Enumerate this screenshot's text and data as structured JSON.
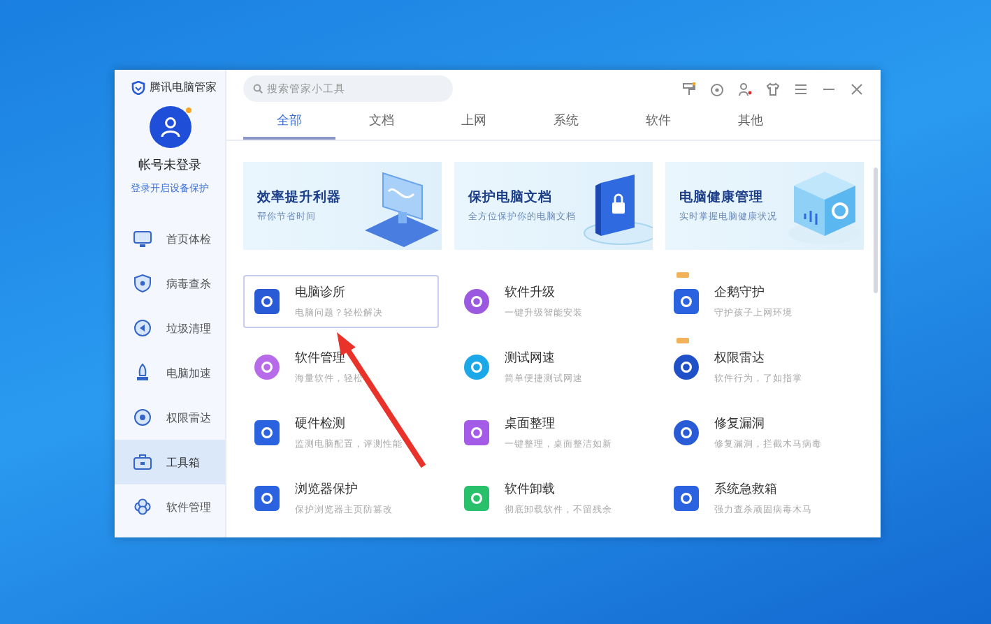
{
  "sidebar": {
    "brand": "腾讯电脑管家",
    "account": {
      "name": "帐号未登录",
      "link": "登录开启设备保护"
    },
    "items": [
      {
        "label": "首页体检",
        "selected": false
      },
      {
        "label": "病毒查杀",
        "selected": false
      },
      {
        "label": "垃圾清理",
        "selected": false
      },
      {
        "label": "电脑加速",
        "selected": false
      },
      {
        "label": "权限雷达",
        "selected": false
      },
      {
        "label": "工具箱",
        "selected": true
      },
      {
        "label": "软件管理",
        "selected": false
      }
    ]
  },
  "search": {
    "placeholder": "搜索管家小工具"
  },
  "tabs": [
    {
      "label": "全部",
      "selected": true
    },
    {
      "label": "文档",
      "selected": false
    },
    {
      "label": "上网",
      "selected": false
    },
    {
      "label": "系统",
      "selected": false
    },
    {
      "label": "软件",
      "selected": false
    },
    {
      "label": "其他",
      "selected": false
    }
  ],
  "banners": [
    {
      "title": "效率提升利器",
      "subtitle": "帮你节省时间"
    },
    {
      "title": "保护电脑文档",
      "subtitle": "全方位保护你的电脑文档"
    },
    {
      "title": "电脑健康管理",
      "subtitle": "实时掌握电脑健康状况"
    }
  ],
  "tools": [
    {
      "name": "电脑诊所",
      "desc": "电脑问题？轻松解决",
      "kind": "square",
      "color": "#2a5bd7",
      "highlighted": true,
      "badge": false
    },
    {
      "name": "软件升级",
      "desc": "一键升级智能安装",
      "kind": "circle",
      "color": "#9b59e0",
      "highlighted": false,
      "badge": false
    },
    {
      "name": "企鹅守护",
      "desc": "守护孩子上网环境",
      "kind": "square",
      "color": "#2a62e0",
      "highlighted": false,
      "badge": true
    },
    {
      "name": "软件管理",
      "desc": "海量软件，轻松",
      "kind": "circle",
      "color": "#b86be8",
      "highlighted": false,
      "badge": false
    },
    {
      "name": "测试网速",
      "desc": "简单便捷测试网速",
      "kind": "circle",
      "color": "#1aa8e8",
      "highlighted": false,
      "badge": false
    },
    {
      "name": "权限雷达",
      "desc": "软件行为，了如指掌",
      "kind": "circle",
      "color": "#2050c8",
      "highlighted": false,
      "badge": true
    },
    {
      "name": "硬件检测",
      "desc": "监测电脑配置，评测性能",
      "kind": "square",
      "color": "#2a62e0",
      "highlighted": false,
      "badge": false
    },
    {
      "name": "桌面整理",
      "desc": "一键整理，桌面整洁如新",
      "kind": "square",
      "color": "#a35be8",
      "highlighted": false,
      "badge": false
    },
    {
      "name": "修复漏洞",
      "desc": "修复漏洞，拦截木马病毒",
      "kind": "circle",
      "color": "#2a5bd7",
      "highlighted": false,
      "badge": false
    },
    {
      "name": "浏览器保护",
      "desc": "保护浏览器主页防篡改",
      "kind": "square",
      "color": "#2a62e0",
      "highlighted": false,
      "badge": false
    },
    {
      "name": "软件卸载",
      "desc": "彻底卸载软件，不留残余",
      "kind": "square",
      "color": "#28c06a",
      "highlighted": false,
      "badge": false
    },
    {
      "name": "系统急救箱",
      "desc": "强力查杀顽固病毒木马",
      "kind": "square",
      "color": "#2a62e0",
      "highlighted": false,
      "badge": false
    }
  ]
}
